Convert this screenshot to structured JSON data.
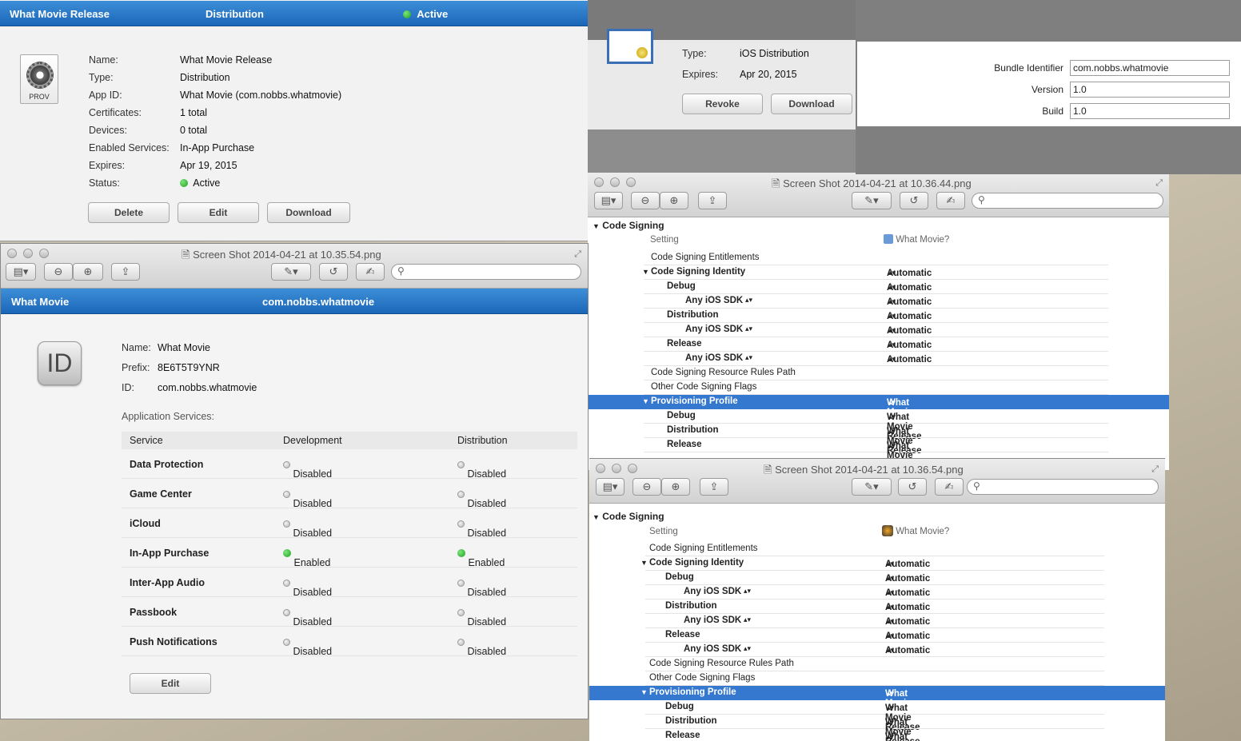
{
  "profile": {
    "header": {
      "name": "What Movie Release",
      "type": "Distribution",
      "status": "Active"
    },
    "icon_label": "PROV",
    "fields": [
      {
        "label": "Name:",
        "value": "What Movie Release"
      },
      {
        "label": "Type:",
        "value": "Distribution"
      },
      {
        "label": "App ID:",
        "value": "What Movie (com.nobbs.whatmovie)"
      },
      {
        "label": "Certificates:",
        "value": "1 total"
      },
      {
        "label": "Devices:",
        "value": "0 total"
      },
      {
        "label": "Enabled Services:",
        "value": "In-App Purchase"
      },
      {
        "label": "Expires:",
        "value": "Apr 19, 2015"
      }
    ],
    "status_label": "Status:",
    "status_value": "Active",
    "buttons": {
      "delete": "Delete",
      "edit": "Edit",
      "download": "Download"
    }
  },
  "certificate": {
    "fields": [
      {
        "label": "Type:",
        "value": "iOS Distribution"
      },
      {
        "label": "Expires:",
        "value": "Apr 20, 2015"
      }
    ],
    "buttons": {
      "revoke": "Revoke",
      "download": "Download"
    }
  },
  "identity": {
    "fields": [
      {
        "label": "Bundle Identifier",
        "value": "com.nobbs.whatmovie"
      },
      {
        "label": "Version",
        "value": "1.0"
      },
      {
        "label": "Build",
        "value": "1.0"
      }
    ]
  },
  "preview_left": {
    "title": "Screen Shot 2014-04-21 at 10.35.54.png",
    "header": {
      "name": "What Movie",
      "bundle": "com.nobbs.whatmovie"
    },
    "icon_label": "ID",
    "fields": [
      {
        "label": "Name:",
        "value": "What Movie"
      },
      {
        "label": "Prefix:",
        "value": "8E6T5T9YNR"
      },
      {
        "label": "ID:",
        "value": "com.nobbs.whatmovie"
      }
    ],
    "services_title": "Application Services:",
    "columns": [
      "Service",
      "Development",
      "Distribution"
    ],
    "services": [
      {
        "name": "Data Protection",
        "dev": "Disabled",
        "dist": "Disabled"
      },
      {
        "name": "Game Center",
        "dev": "Disabled",
        "dist": "Disabled"
      },
      {
        "name": "iCloud",
        "dev": "Disabled",
        "dist": "Disabled"
      },
      {
        "name": "In-App Purchase",
        "dev": "Enabled",
        "dist": "Enabled"
      },
      {
        "name": "Inter-App Audio",
        "dev": "Disabled",
        "dist": "Disabled"
      },
      {
        "name": "Passbook",
        "dev": "Disabled",
        "dist": "Disabled"
      },
      {
        "name": "Push Notifications",
        "dev": "Disabled",
        "dist": "Disabled"
      }
    ],
    "edit_button": "Edit"
  },
  "preview_top": {
    "title": "Screen Shot 2014-04-21 at 10.36.44.png",
    "section": "Code Signing",
    "setting_header": "Setting",
    "target_header": "What Movie?",
    "rows": [
      {
        "label": "Code Signing Entitlements",
        "value": "",
        "indent": 0,
        "bold": false,
        "tri": false,
        "sel": false
      },
      {
        "label": "Code Signing Identity",
        "value": "Automatic",
        "indent": 0,
        "bold": true,
        "tri": true,
        "sel": false
      },
      {
        "label": "Debug",
        "value": "Automatic",
        "indent": 1,
        "bold": true,
        "tri": false,
        "sel": false
      },
      {
        "label": "Any iOS SDK",
        "value": "Automatic",
        "indent": 2,
        "bold": true,
        "tri": false,
        "sel": false,
        "stepper": true
      },
      {
        "label": "Distribution",
        "value": "Automatic",
        "indent": 1,
        "bold": true,
        "tri": false,
        "sel": false
      },
      {
        "label": "Any iOS SDK",
        "value": "Automatic",
        "indent": 2,
        "bold": true,
        "tri": false,
        "sel": false,
        "stepper": true
      },
      {
        "label": "Release",
        "value": "Automatic",
        "indent": 1,
        "bold": true,
        "tri": false,
        "sel": false
      },
      {
        "label": "Any iOS SDK",
        "value": "Automatic",
        "indent": 2,
        "bold": true,
        "tri": false,
        "sel": false,
        "stepper": true
      },
      {
        "label": "Code Signing Resource Rules Path",
        "value": "",
        "indent": 0,
        "bold": false,
        "tri": false,
        "sel": false
      },
      {
        "label": "Other Code Signing Flags",
        "value": "",
        "indent": 0,
        "bold": false,
        "tri": false,
        "sel": false
      },
      {
        "label": "Provisioning Profile",
        "value": "What Movie Release",
        "indent": 0,
        "bold": true,
        "tri": true,
        "sel": true
      },
      {
        "label": "Debug",
        "value": "What Movie Release",
        "indent": 1,
        "bold": true,
        "tri": false,
        "sel": false
      },
      {
        "label": "Distribution",
        "value": "What Movie Release",
        "indent": 1,
        "bold": true,
        "tri": false,
        "sel": false
      },
      {
        "label": "Release",
        "value": "What Movie Release",
        "indent": 1,
        "bold": true,
        "tri": false,
        "sel": false
      }
    ]
  },
  "preview_bottom": {
    "title": "Screen Shot 2014-04-21 at 10.36.54.png",
    "section": "Code Signing",
    "setting_header": "Setting",
    "target_header": "What Movie?",
    "rows": [
      {
        "label": "Code Signing Entitlements",
        "value": "",
        "indent": 0,
        "bold": false,
        "tri": false,
        "sel": false
      },
      {
        "label": "Code Signing Identity",
        "value": "Automatic",
        "indent": 0,
        "bold": true,
        "tri": true,
        "sel": false
      },
      {
        "label": "Debug",
        "value": "Automatic",
        "indent": 1,
        "bold": true,
        "tri": false,
        "sel": false
      },
      {
        "label": "Any iOS SDK",
        "value": "Automatic",
        "indent": 2,
        "bold": true,
        "tri": false,
        "sel": false,
        "stepper": true
      },
      {
        "label": "Distribution",
        "value": "Automatic",
        "indent": 1,
        "bold": true,
        "tri": false,
        "sel": false
      },
      {
        "label": "Any iOS SDK",
        "value": "Automatic",
        "indent": 2,
        "bold": true,
        "tri": false,
        "sel": false,
        "stepper": true
      },
      {
        "label": "Release",
        "value": "Automatic",
        "indent": 1,
        "bold": true,
        "tri": false,
        "sel": false
      },
      {
        "label": "Any iOS SDK",
        "value": "Automatic",
        "indent": 2,
        "bold": true,
        "tri": false,
        "sel": false,
        "stepper": true
      },
      {
        "label": "Code Signing Resource Rules Path",
        "value": "",
        "indent": 0,
        "bold": false,
        "tri": false,
        "sel": false
      },
      {
        "label": "Other Code Signing Flags",
        "value": "",
        "indent": 0,
        "bold": false,
        "tri": false,
        "sel": false
      },
      {
        "label": "Provisioning Profile",
        "value": "What Movie Release",
        "indent": 0,
        "bold": true,
        "tri": true,
        "sel": true
      },
      {
        "label": "Debug",
        "value": "What Movie Release",
        "indent": 1,
        "bold": true,
        "tri": false,
        "sel": false
      },
      {
        "label": "Distribution",
        "value": "What Movie Release",
        "indent": 1,
        "bold": true,
        "tri": false,
        "sel": false
      },
      {
        "label": "Release",
        "value": "What Movie Release",
        "indent": 1,
        "bold": true,
        "tri": false,
        "sel": false
      }
    ]
  },
  "colors": {
    "header_blue": "#1b67b8",
    "selection": "#3478d0",
    "enabled_green": "#1aa31a"
  }
}
